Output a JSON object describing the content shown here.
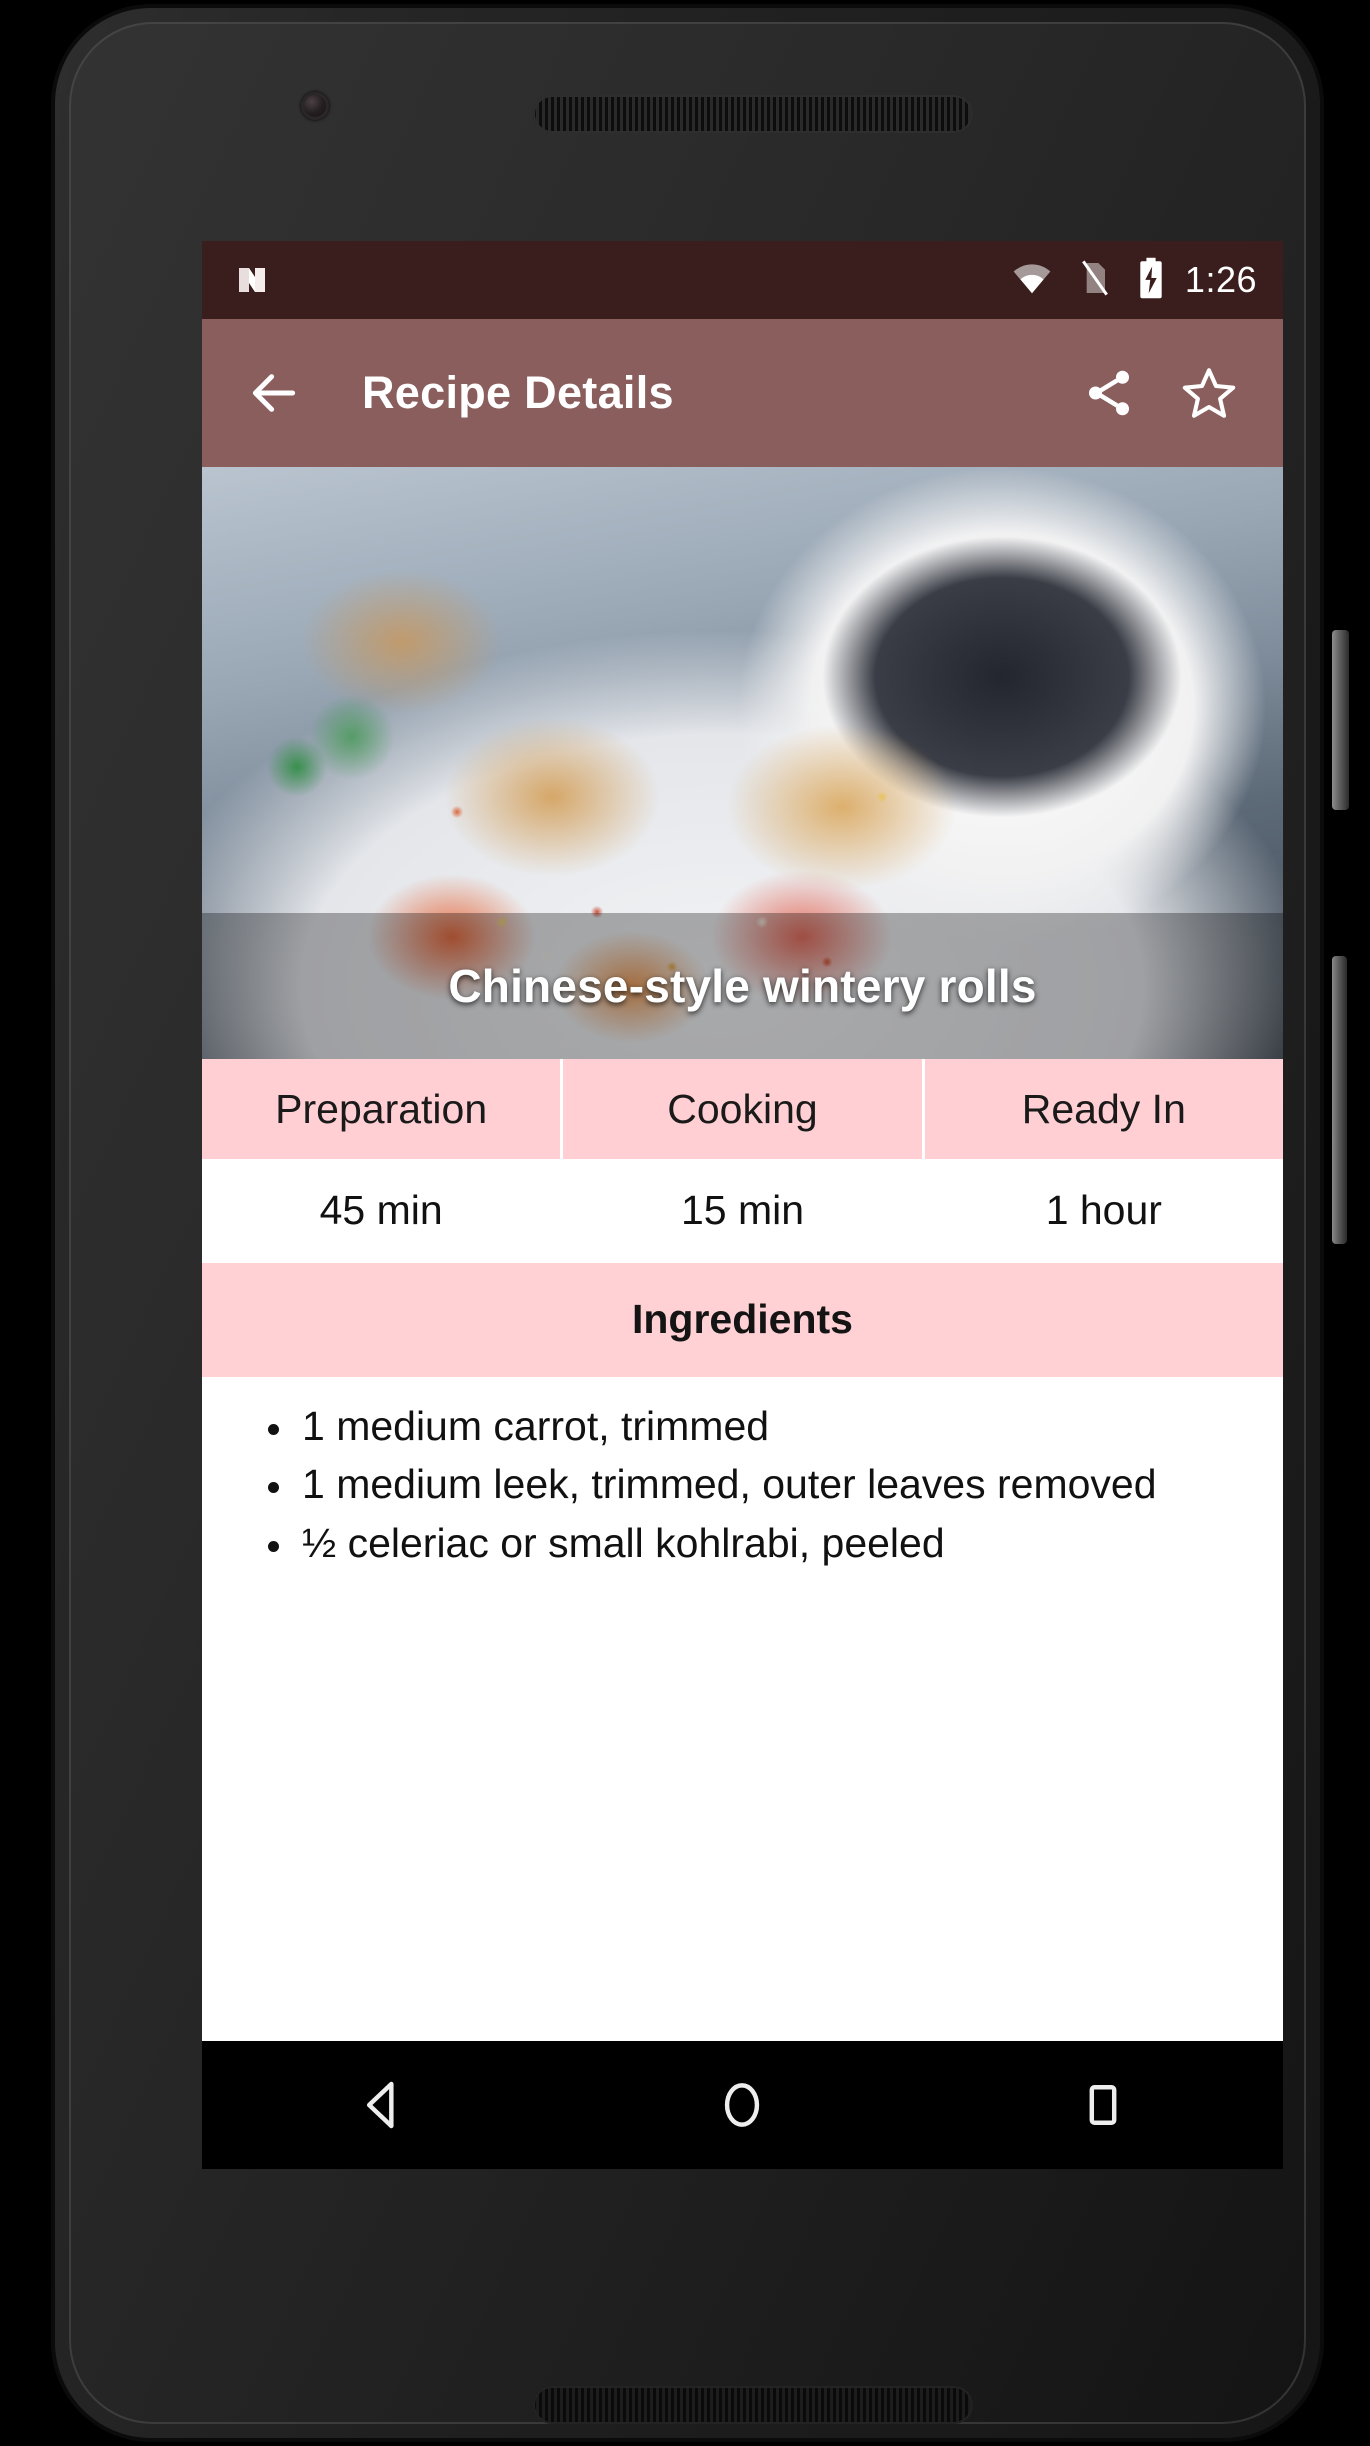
{
  "device": {
    "camera_icon": "front-camera-icon",
    "earpiece_icon": "earpiece-speaker",
    "bottom_speaker_icon": "bottom-speaker",
    "power_button": "power-button",
    "volume_rocker": "volume-rocker"
  },
  "status_bar": {
    "logo_icon": "android-n-logo",
    "icons": [
      "wifi-icon",
      "no-sim-icon",
      "battery-charging-icon"
    ],
    "time": "1:26",
    "background": "#3a1d1d"
  },
  "app_bar": {
    "back_icon": "back-arrow-icon",
    "title": "Recipe Details",
    "share_icon": "share-icon",
    "favorite_icon": "star-outline-icon",
    "background": "#8b5e5e",
    "text_color": "#ffffff"
  },
  "hero": {
    "image_alt": "Chinese-style wintery rolls on a white plate with dipping sauce",
    "title": "Chinese-style wintery rolls"
  },
  "times": {
    "headers": [
      "Preparation",
      "Cooking",
      "Ready In"
    ],
    "values": [
      "45 min",
      "15 min",
      "1 hour"
    ],
    "header_background": "#ffcfd3"
  },
  "ingredients": {
    "header": "Ingredients",
    "header_background": "#ffd0d4",
    "items": [
      "1 medium carrot, trimmed",
      "1 medium leek, trimmed, outer leaves removed",
      "½ celeriac or small kohlrabi, peeled"
    ]
  },
  "nav_bar": {
    "back": "nav-back-icon",
    "home": "nav-home-icon",
    "recents": "nav-recents-icon"
  }
}
